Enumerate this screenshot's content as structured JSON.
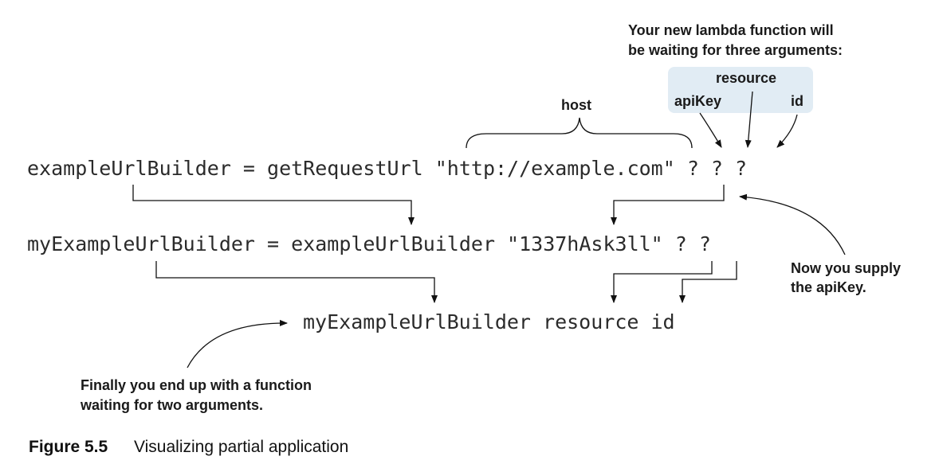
{
  "annotations": {
    "lambda_line1": "Your new lambda function will",
    "lambda_line2": "be waiting for three arguments:",
    "arg_resource": "resource",
    "arg_apikey": "apiKey",
    "arg_id": "id",
    "host": "host",
    "supply_line1": "Now you supply",
    "supply_line2": "the apiKey.",
    "final_line1": "Finally you end up with a function",
    "final_line2": "waiting for two arguments."
  },
  "code": {
    "line1": "exampleUrlBuilder = getRequestUrl \"http://example.com\" ? ? ?",
    "line2": "myExampleUrlBuilder = exampleUrlBuilder \"1337hAsk3ll\" ? ?",
    "line3": "myExampleUrlBuilder resource id"
  },
  "caption": {
    "number": "Figure 5.5",
    "text": "Visualizing partial application"
  },
  "colors": {
    "args_box": "#e1ecf4",
    "ink": "#111111",
    "code_text": "#2b2b2b"
  }
}
